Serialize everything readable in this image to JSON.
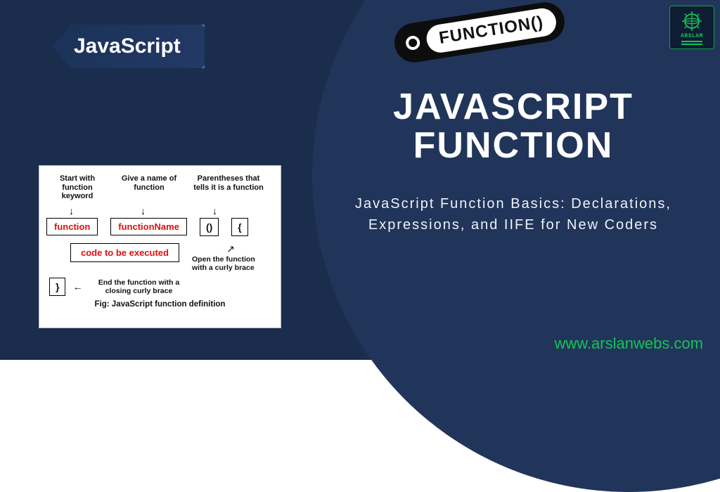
{
  "brand": {
    "tag": "JavaScript",
    "logo_text": "ARSLAM",
    "url": "www.arslanwebs.com"
  },
  "pill": {
    "label": "FUNCTION()"
  },
  "hero": {
    "title": "JAVASCRIPT FUNCTION",
    "subtitle": "JavaScript Function Basics: Declarations, Expressions, and IIFE for New Coders"
  },
  "diagram": {
    "labels": {
      "start": "Start with function keyword",
      "name": "Give a name of function",
      "parens": "Parentheses that tells it is a function",
      "open_brace": "Open the function with a curly brace",
      "close_brace": "End the function with a closing curly brace"
    },
    "tokens": {
      "keyword": "function",
      "identifier": "functionName",
      "parens": "()",
      "open": "{",
      "body": "code to be executed",
      "close": "}"
    },
    "caption": "Fig: JavaScript function definition"
  },
  "colors": {
    "accent_green": "#17c257",
    "code_red": "#d11",
    "bg_dark": "#1a2d4d",
    "bg_ellipse": "#21355a"
  }
}
